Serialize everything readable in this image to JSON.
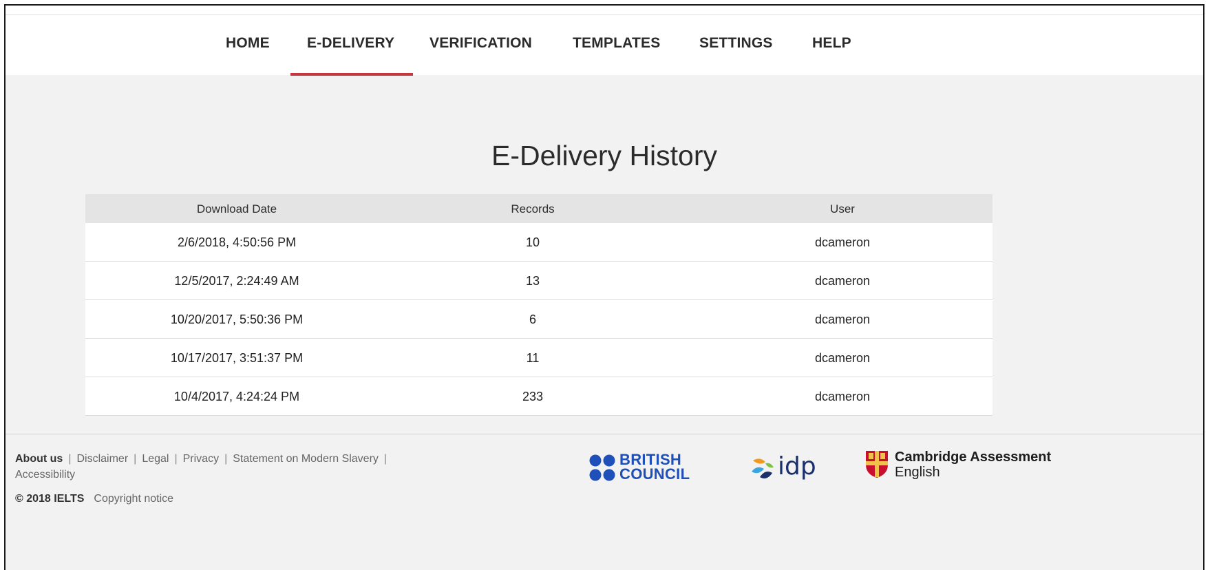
{
  "nav": {
    "items": [
      "HOME",
      "E-DELIVERY",
      "VERIFICATION",
      "TEMPLATES",
      "SETTINGS",
      "HELP"
    ],
    "active": "E-DELIVERY"
  },
  "page": {
    "heading": "E-Delivery History"
  },
  "table": {
    "headers": {
      "date": "Download Date",
      "records": "Records",
      "user": "User"
    },
    "rows": [
      {
        "date": "2/6/2018, 4:50:56 PM",
        "records": "10",
        "user": "dcameron"
      },
      {
        "date": "12/5/2017, 2:24:49 AM",
        "records": "13",
        "user": "dcameron"
      },
      {
        "date": "10/20/2017, 5:50:36 PM",
        "records": "6",
        "user": "dcameron"
      },
      {
        "date": "10/17/2017, 3:51:37 PM",
        "records": "11",
        "user": "dcameron"
      },
      {
        "date": "10/4/2017, 4:24:24 PM",
        "records": "233",
        "user": "dcameron"
      }
    ]
  },
  "footer": {
    "links": [
      "About us",
      "Disclaimer",
      "Legal",
      "Privacy",
      "Statement on Modern Slavery",
      "Accessibility"
    ],
    "copyright_brand": "© 2018 IELTS",
    "copyright_link": "Copyright notice",
    "british_council": {
      "line1": "BRITISH",
      "line2": "COUNCIL"
    },
    "idp": "idp",
    "cambridge": {
      "line1": "Cambridge Assessment",
      "line2": "English"
    }
  },
  "colors": {
    "accent_underline": "#c7363f",
    "british_council_blue": "#1f4fb8",
    "idp_navy": "#1b2f6b"
  }
}
